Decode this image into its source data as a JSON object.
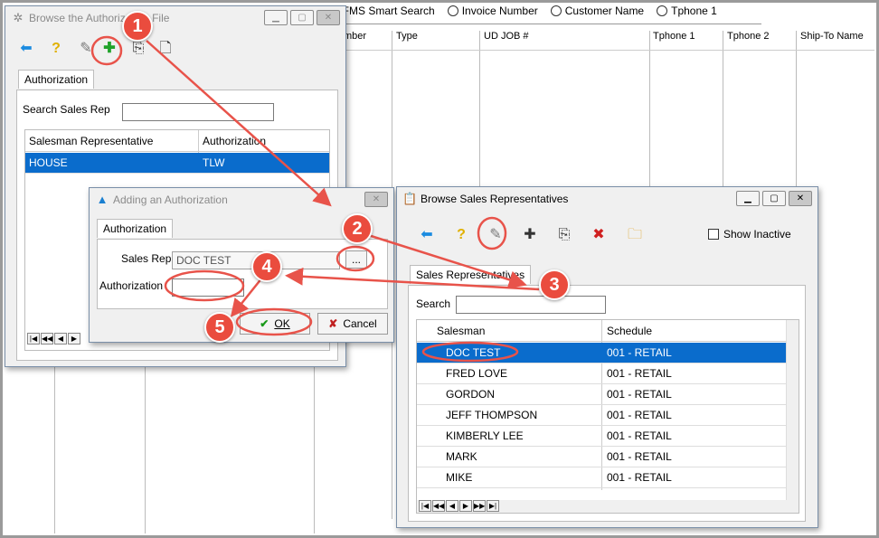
{
  "background": {
    "radios": [
      "RFMS Smart Search",
      "Invoice Number",
      "Customer Name",
      "Tphone 1"
    ],
    "columns": [
      "mber",
      "Type",
      "UD JOB #",
      "Tphone 1",
      "Tphone 2",
      "Ship-To Name"
    ]
  },
  "auth_window": {
    "title": "Browse the Authorization File",
    "tab": "Authorization",
    "search_label": "Search Sales Rep",
    "search_value": "",
    "columns": [
      "Salesman Representative",
      "Authorization"
    ],
    "rows": [
      {
        "rep": "HOUSE",
        "auth": "TLW"
      }
    ]
  },
  "add_dialog": {
    "title": "Adding an Authorization",
    "tab": "Authorization",
    "sales_rep_label": "Sales Rep",
    "sales_rep_value": "DOC TEST",
    "authorization_label": "Authorization",
    "authorization_value": "",
    "browse_label": "...",
    "ok_label": "OK",
    "cancel_label": "Cancel"
  },
  "reps_window": {
    "title": "Browse Sales Representatives",
    "show_inactive_label": "Show Inactive",
    "tab": "Sales Representatives",
    "search_label": "Search",
    "search_value": "",
    "columns": [
      "Salesman",
      "Schedule"
    ],
    "rows": [
      {
        "name": "DOC TEST",
        "schedule": "001 - RETAIL"
      },
      {
        "name": "FRED LOVE",
        "schedule": "001 - RETAIL"
      },
      {
        "name": "GORDON",
        "schedule": "001 - RETAIL"
      },
      {
        "name": "JEFF THOMPSON",
        "schedule": "001 - RETAIL"
      },
      {
        "name": "KIMBERLY LEE",
        "schedule": "001 - RETAIL"
      },
      {
        "name": "MARK",
        "schedule": "001 - RETAIL"
      },
      {
        "name": "MIKE",
        "schedule": "001 - RETAIL"
      }
    ]
  },
  "steps": [
    "1",
    "2",
    "3",
    "4",
    "5"
  ],
  "colors": {
    "selection": "#0a6ccc",
    "annotation": "#ea4c3e",
    "arrow": "#e8534a"
  },
  "icons": [
    "back-arrow-icon",
    "help-icon",
    "edit-icon",
    "add-icon",
    "copy-icon",
    "delete-icon",
    "folder-add-icon",
    "checkmark-icon",
    "x-icon"
  ]
}
